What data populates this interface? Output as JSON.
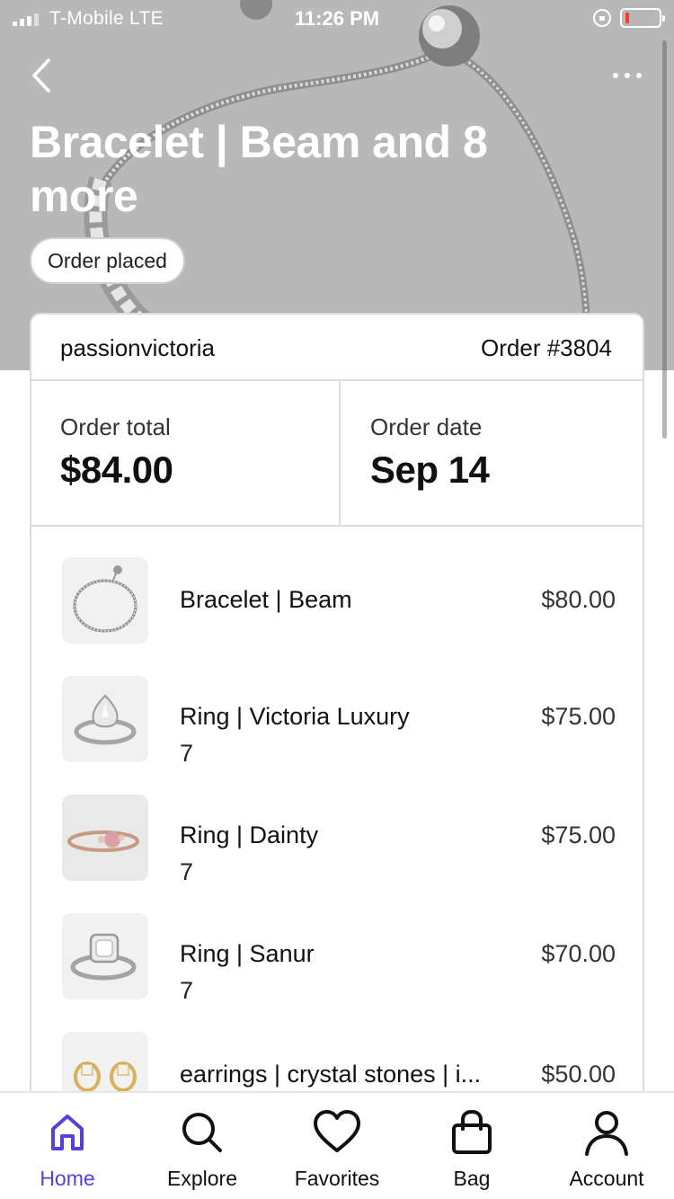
{
  "status_bar": {
    "carrier": "T-Mobile  LTE",
    "time": "11:26 PM"
  },
  "header": {
    "title": "Bracelet | Beam and 8 more",
    "status": "Order placed",
    "back_icon": "chevron-left-icon",
    "more_icon": "more-horizontal-icon"
  },
  "order": {
    "shop": "passionvictoria",
    "number": "Order #3804",
    "total_label": "Order total",
    "total": "$84.00",
    "date_label": "Order date",
    "date": "Sep 14"
  },
  "items": [
    {
      "name": "Bracelet | Beam",
      "size": "",
      "price": "$80.00",
      "thumb": "bracelet"
    },
    {
      "name": "Ring | Victoria Luxury",
      "size": "7",
      "price": "$75.00",
      "thumb": "pear-ring"
    },
    {
      "name": "Ring | Dainty",
      "size": "7",
      "price": "$75.00",
      "thumb": "rose-ring"
    },
    {
      "name": "Ring | Sanur",
      "size": "7",
      "price": "$70.00",
      "thumb": "cushion-ring"
    },
    {
      "name": "earrings | crystal stones | i...",
      "size": "",
      "price": "$50.00",
      "thumb": "earrings"
    }
  ],
  "tabbar": {
    "active_color": "#5a3ddd",
    "tabs": [
      {
        "label": "Home",
        "icon": "home-icon"
      },
      {
        "label": "Explore",
        "icon": "search-icon"
      },
      {
        "label": "Favorites",
        "icon": "heart-icon"
      },
      {
        "label": "Bag",
        "icon": "bag-icon"
      },
      {
        "label": "Account",
        "icon": "user-icon"
      }
    ]
  }
}
